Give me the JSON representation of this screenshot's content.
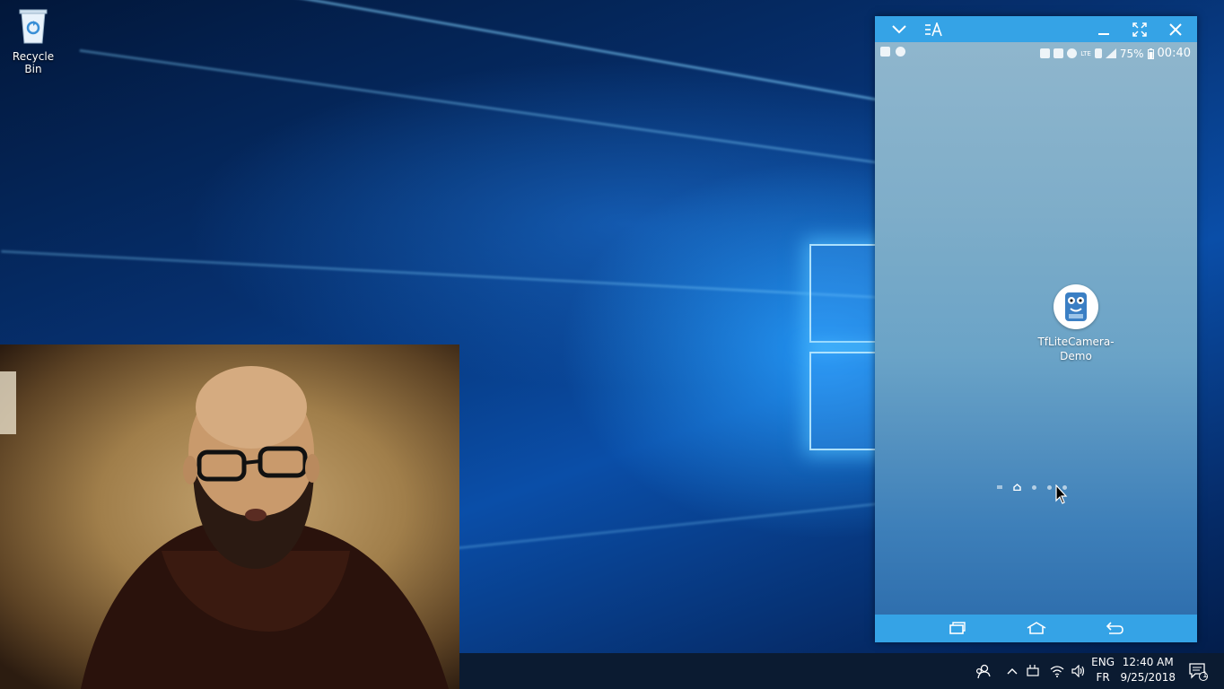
{
  "desktop": {
    "icons": [
      {
        "label": "Recycle Bin",
        "icon": "recycle-bin-icon"
      }
    ]
  },
  "phone_window": {
    "title_icons": [
      "chevron-down-icon",
      "text-size-icon",
      "minimize-icon",
      "fullscreen-icon",
      "close-icon"
    ],
    "status_bar": {
      "battery": "75%",
      "time": "00:40",
      "network": "LTE"
    },
    "home_screen": {
      "app_label": "TfLiteCamera-Demo",
      "pages": 4,
      "current_page": 1
    },
    "navbar_icons": [
      "recent-apps-icon",
      "home-icon",
      "back-icon"
    ]
  },
  "taskbar": {
    "language_top": "ENG",
    "language_bottom": "FR",
    "time": "12:40 AM",
    "date": "9/25/2018",
    "notification_count": "1"
  },
  "colors": {
    "phone_accent": "#35a3e6",
    "taskbar": "#0b1b31"
  }
}
